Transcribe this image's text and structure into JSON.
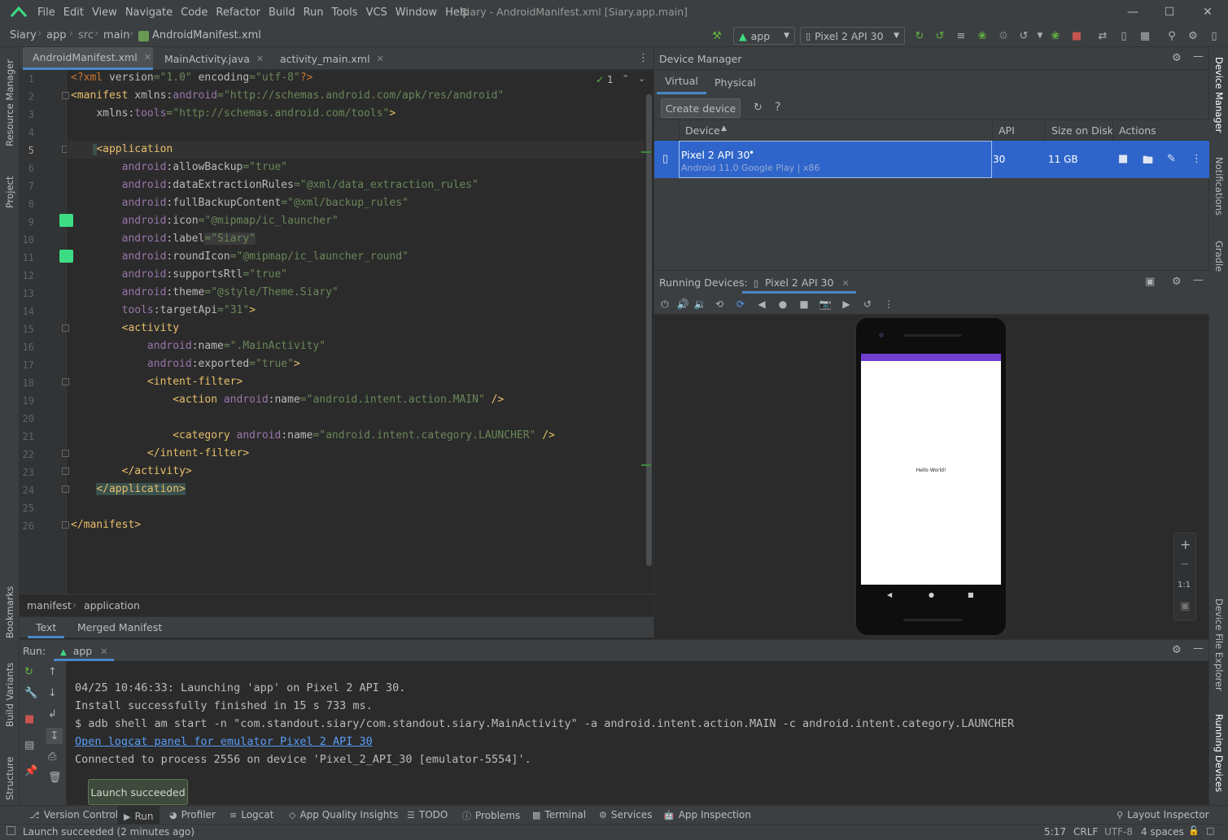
{
  "window": {
    "title": "Siary - AndroidManifest.xml [Siary.app.main]",
    "menu": [
      "File",
      "Edit",
      "View",
      "Navigate",
      "Code",
      "Refactor",
      "Build",
      "Run",
      "Tools",
      "VCS",
      "Window",
      "Help"
    ]
  },
  "breadcrumb": [
    "Siary",
    "app",
    "src",
    "main",
    "AndroidManifest.xml"
  ],
  "toolbar": {
    "run_config": "app",
    "device": "Pixel 2 API 30"
  },
  "editor": {
    "tabs": [
      {
        "label": "AndroidManifest.xml",
        "active": true
      },
      {
        "label": "MainActivity.java",
        "active": false
      },
      {
        "label": "activity_main.xml",
        "active": false
      }
    ],
    "inspection_count": "1",
    "line_numbers": [
      "1",
      "2",
      "3",
      "4",
      "5",
      "6",
      "7",
      "8",
      "9",
      "10",
      "11",
      "12",
      "13",
      "14",
      "15",
      "16",
      "17",
      "18",
      "19",
      "20",
      "21",
      "22",
      "23",
      "24",
      "25",
      "26"
    ],
    "path": [
      "manifest",
      "application"
    ],
    "bottom_tabs": [
      "Text",
      "Merged Manifest"
    ]
  },
  "device_manager": {
    "title": "Device Manager",
    "tabs": [
      "Virtual",
      "Physical"
    ],
    "create_label": "Create device",
    "help": "?",
    "columns": [
      "Device",
      "API",
      "Size on Disk",
      "Actions"
    ],
    "device": {
      "name": "Pixel 2 API 30",
      "status_dot": "•",
      "detail": "Android 11.0 Google Play | x86",
      "api": "30",
      "size": "11 GB"
    }
  },
  "running_devices": {
    "label": "Running Devices:",
    "tab": "Pixel 2 API 30",
    "screen_text": "Hello World!",
    "zoom_ratio": "1:1"
  },
  "run": {
    "label": "Run:",
    "config": "app",
    "lines": [
      "04/25 10:46:33: Launching 'app' on Pixel 2 API 30.",
      "Install successfully finished in 15 s 733 ms.",
      "$ adb shell am start -n \"com.standout.siary/com.standout.siary.MainActivity\" -a android.intent.action.MAIN -c android.intent.category.LAUNCHER"
    ],
    "link": "Open logcat panel for emulator Pixel 2 API 30",
    "connected": "Connected to process 2556 on device 'Pixel_2_API_30 [emulator-5554]'.",
    "toast": "Launch succeeded"
  },
  "side_left": [
    "Resource Manager",
    "Project",
    "Bookmarks",
    "Build Variants",
    "Structure"
  ],
  "side_right": [
    "Device Manager",
    "Notifications",
    "Gradle",
    "Device File Explorer",
    "Running Devices"
  ],
  "tool_windows": [
    "Version Control",
    "Run",
    "Profiler",
    "Logcat",
    "App Quality Insights",
    "TODO",
    "Problems",
    "Terminal",
    "Services",
    "App Inspection"
  ],
  "layout_inspector": "Layout Inspector",
  "status": {
    "message": "Launch succeeded (2 minutes ago)",
    "position": "5:17",
    "line_sep": "CRLF",
    "encoding": "UTF-8",
    "indent": "4 spaces"
  },
  "colors": {
    "accent": "#4a88c7",
    "selection": "#2f65ca",
    "android_green": "#3ddc84",
    "stop_red": "#c75450"
  }
}
